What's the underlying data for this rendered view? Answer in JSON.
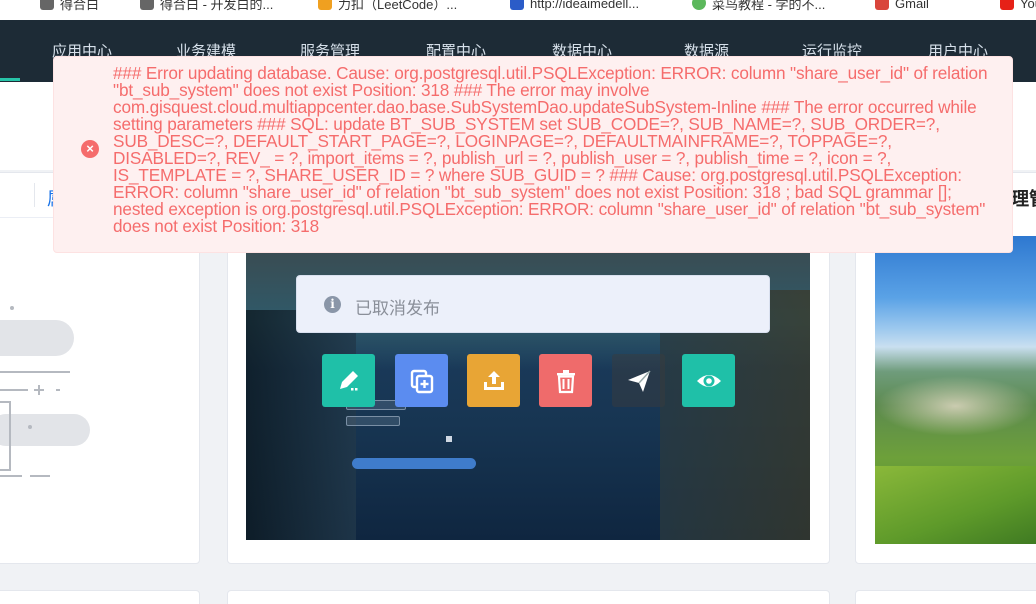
{
  "bookmarks": [
    {
      "label": "得合白",
      "color": "#555555"
    },
    {
      "label": "得合白 - 开发白的...",
      "color": "#555555"
    },
    {
      "label": "力扣（LeetCode）...",
      "color": "#f0a020"
    },
    {
      "label": "http://ideaimedell...",
      "color": "#2b5cc8"
    },
    {
      "label": "菜鸟教程 - 学的不...",
      "color": "#5cb85c"
    },
    {
      "label": "Gmail",
      "color": "#d9453b"
    },
    {
      "label": "You",
      "color": "#e62117"
    }
  ],
  "nav": {
    "accent_color": "#27c4a8",
    "items": [
      "应用中心",
      "业务建模",
      "服务管理",
      "配置中心",
      "数据中心",
      "数据源",
      "运行监控",
      "用户中心"
    ]
  },
  "left_card": {
    "tab_label": "属"
  },
  "right_card": {
    "title_fragment": "理管"
  },
  "preview_status": {
    "icon": "info-circle-icon",
    "text": "已取消发布"
  },
  "actions": [
    {
      "name": "edit-button",
      "icon": "edit-icon",
      "color": "#1fc0a8"
    },
    {
      "name": "copy-button",
      "icon": "copy-icon",
      "color": "#5b8cf0"
    },
    {
      "name": "export-button",
      "icon": "upload-icon",
      "color": "#e8a535"
    },
    {
      "name": "delete-button",
      "icon": "trash-icon",
      "color": "#ef6b6b"
    },
    {
      "name": "publish-button",
      "icon": "send-icon",
      "color": "rgba(60,60,60,0.45)"
    },
    {
      "name": "preview-button",
      "icon": "eye-icon",
      "color": "#1fc0a8"
    }
  ],
  "error_toast": {
    "icon": "close-circle-icon",
    "color": "#f56c6c",
    "message": "### Error updating database. Cause: org.postgresql.util.PSQLException: ERROR: column \"share_user_id\" of relation \"bt_sub_system\" does not exist Position: 318 ### The error may involve com.gisquest.cloud.multiappcenter.dao.base.SubSystemDao.updateSubSystem-Inline ### The error occurred while setting parameters ### SQL: update BT_SUB_SYSTEM set SUB_CODE=?, SUB_NAME=?, SUB_ORDER=?, SUB_DESC=?, DEFAULT_START_PAGE=?, LOGINPAGE=?, DEFAULTMAINFRAME=?, TOPPAGE=?, DISABLED=?, REV_ = ?, import_items = ?, publish_url = ?, publish_user = ?, publish_time = ?, icon = ?, IS_TEMPLATE = ?, SHARE_USER_ID = ? where SUB_GUID = ? ### Cause: org.postgresql.util.PSQLException: ERROR: column \"share_user_id\" of relation \"bt_sub_system\" does not exist Position: 318 ; bad SQL grammar []; nested exception is org.postgresql.util.PSQLException: ERROR: column \"share_user_id\" of relation \"bt_sub_system\" does not exist Position: 318"
  }
}
